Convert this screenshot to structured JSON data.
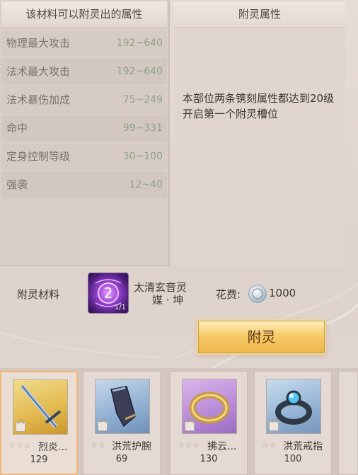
{
  "attr_panel": {
    "title": "该材料可以附灵出的属性",
    "rows": [
      {
        "name": "物理最大攻击",
        "range": "192~640"
      },
      {
        "name": "法术最大攻击",
        "range": "192~640"
      },
      {
        "name": "法术暴伤加成",
        "range": "75~249"
      },
      {
        "name": "命中",
        "range": "99~331"
      },
      {
        "name": "定身控制等级",
        "range": "30~100"
      },
      {
        "name": "强袭",
        "range": "12~40"
      }
    ]
  },
  "enchant_panel": {
    "title": "附灵属性",
    "description": "本部位两条镌刻属性都达到20级开启第一个附灵槽位"
  },
  "material": {
    "label": "附灵材料",
    "item_name_line1": "太清玄音灵",
    "item_name_line2": "媒 · 坤",
    "count": "1/1",
    "cost_label": "花费:",
    "cost_value": "1000",
    "icon": "silver-coin-icon"
  },
  "enchant_button": {
    "label": "附灵"
  },
  "equipment": [
    {
      "stars": "☆☆☆",
      "name": "烈炎...",
      "level": "129",
      "icon": "sword-icon",
      "selected": true
    },
    {
      "stars": "☆☆",
      "name": "洪荒护腕",
      "level": "69",
      "icon": "bracer-icon",
      "selected": false
    },
    {
      "stars": "☆☆☆",
      "name": "拂云...",
      "level": "130",
      "icon": "gold-ring-icon",
      "selected": false
    },
    {
      "stars": "☆☆",
      "name": "洪荒戒指",
      "level": "100",
      "icon": "gem-ring-icon",
      "selected": false
    }
  ],
  "colors": {
    "range_text": "#8fa185",
    "button_gold": "#f6cb68",
    "selected_border": "#f3b67a"
  }
}
